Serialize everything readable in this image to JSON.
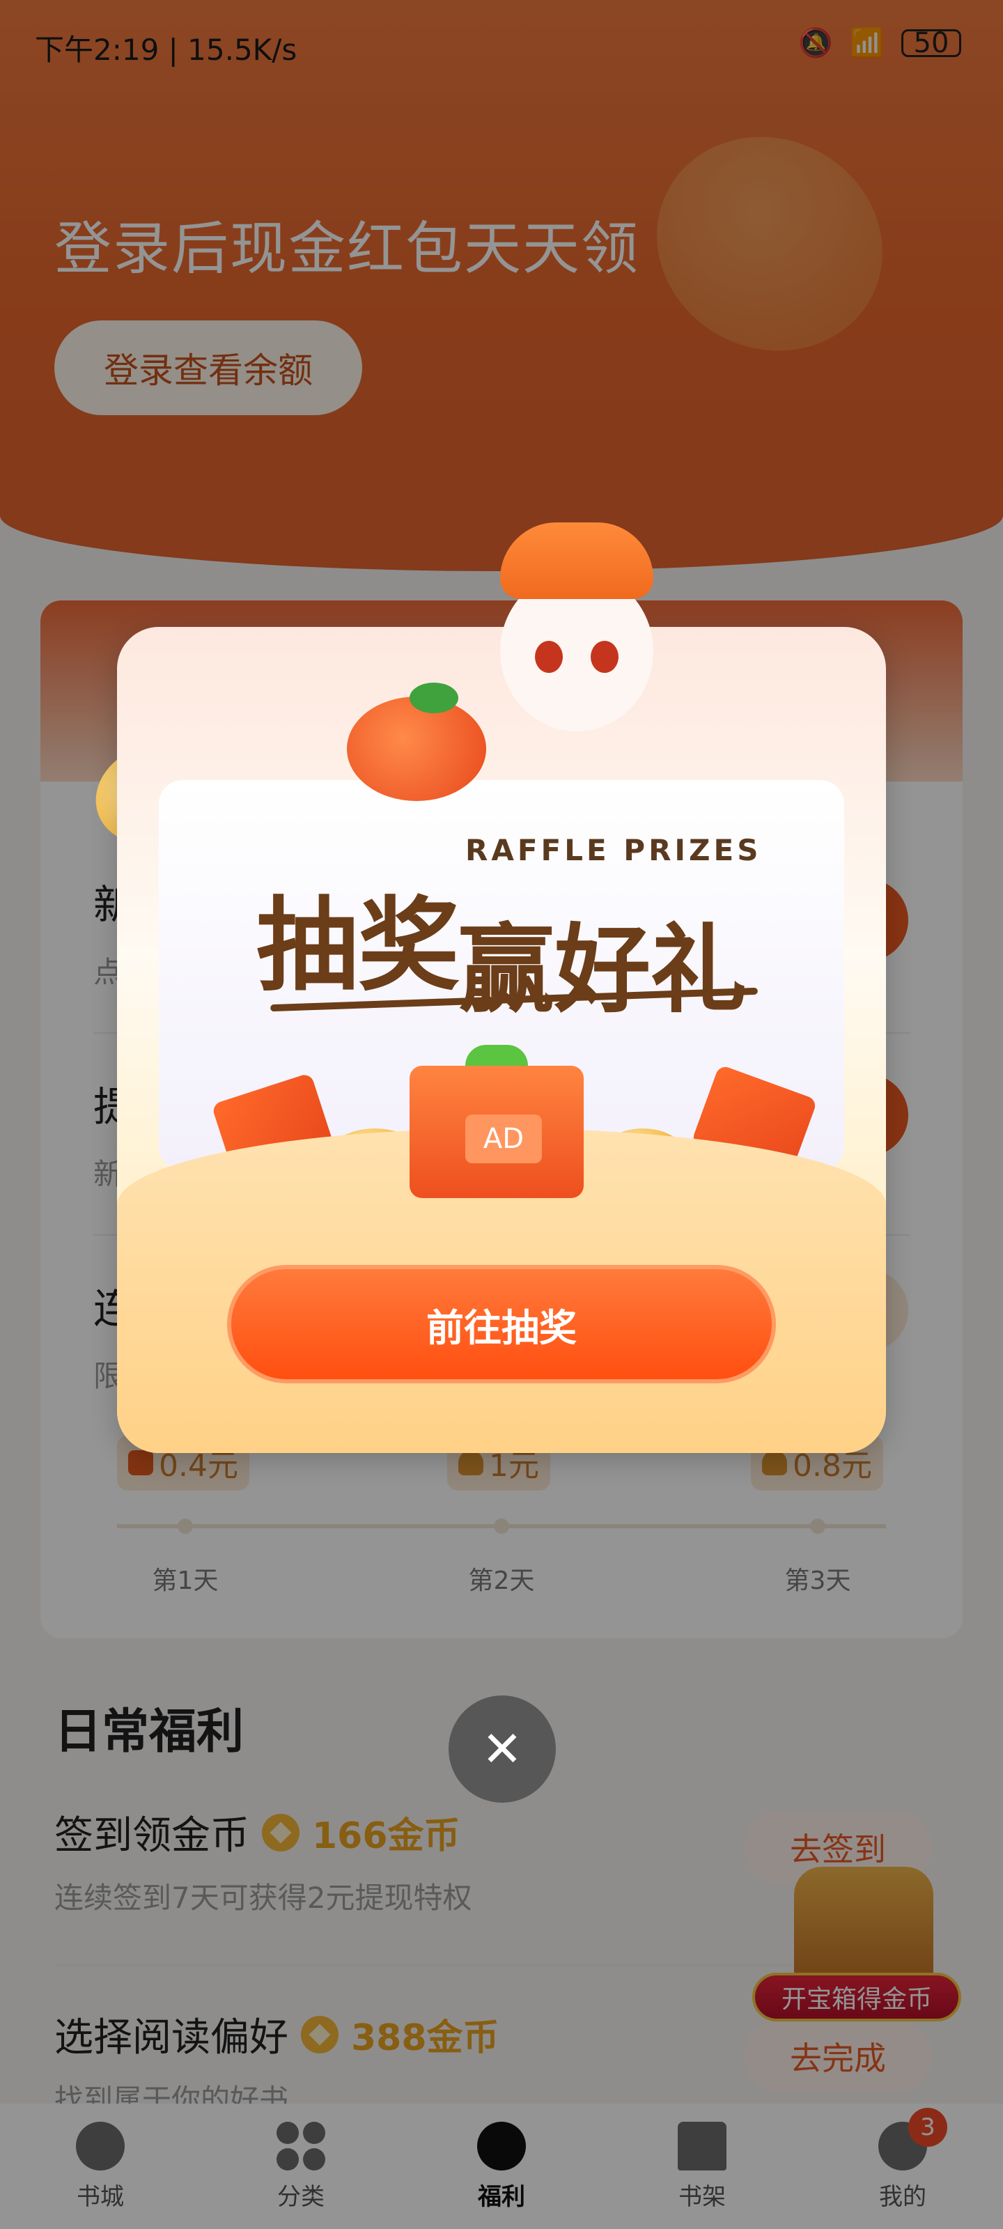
{
  "status_bar": {
    "time": "下午2:19 | 15.5K/s",
    "battery": "50",
    "icons": [
      "mute-bell-icon",
      "wifi-icon",
      "battery-icon"
    ]
  },
  "hero": {
    "title": "登录后现金红包天天领",
    "login_button": "登录查看余额"
  },
  "sign_card": {
    "rows": [
      {
        "title_peek": "新",
        "sub_peek": "点"
      },
      {
        "title_peek": "提",
        "sub_peek": "新"
      },
      {
        "title_peek": "连",
        "sub_peek": "限"
      }
    ],
    "days": [
      {
        "reward": "0.4元",
        "icon": "redpacket-icon",
        "label": "第1天"
      },
      {
        "reward": "1元",
        "icon": "trophy-icon",
        "label": "第2天"
      },
      {
        "reward": "0.8元",
        "icon": "trophy-icon",
        "label": "第3天"
      }
    ]
  },
  "daily": {
    "title": "日常福利",
    "tasks": [
      {
        "name": "签到领金币",
        "coins": "166金币",
        "desc": "连续签到7天可获得2元提现特权",
        "button": "去签到"
      },
      {
        "name": "选择阅读偏好",
        "coins": "388金币",
        "desc": "找到属于你的好书",
        "button": "去完成"
      }
    ]
  },
  "treasure": {
    "label": "开宝箱得金币"
  },
  "tabbar": {
    "tabs": [
      {
        "label": "书城",
        "icon": "compass-icon"
      },
      {
        "label": "分类",
        "icon": "grid-icon"
      },
      {
        "label": "福利",
        "icon": "welfare-icon",
        "active": true
      },
      {
        "label": "书架",
        "icon": "book-icon"
      },
      {
        "label": "我的",
        "icon": "user-icon",
        "badge": "3"
      }
    ]
  },
  "modal": {
    "subtitle": "RAFFLE PRIZES",
    "title_part1": "抽奖",
    "title_part2": "赢好礼",
    "gift_label": "AD",
    "cta": "前往抽奖",
    "close_icon": "close-icon"
  },
  "colors": {
    "brand": "#e8672c",
    "cta": "#ff5a1a",
    "coin": "#e8a21f"
  }
}
